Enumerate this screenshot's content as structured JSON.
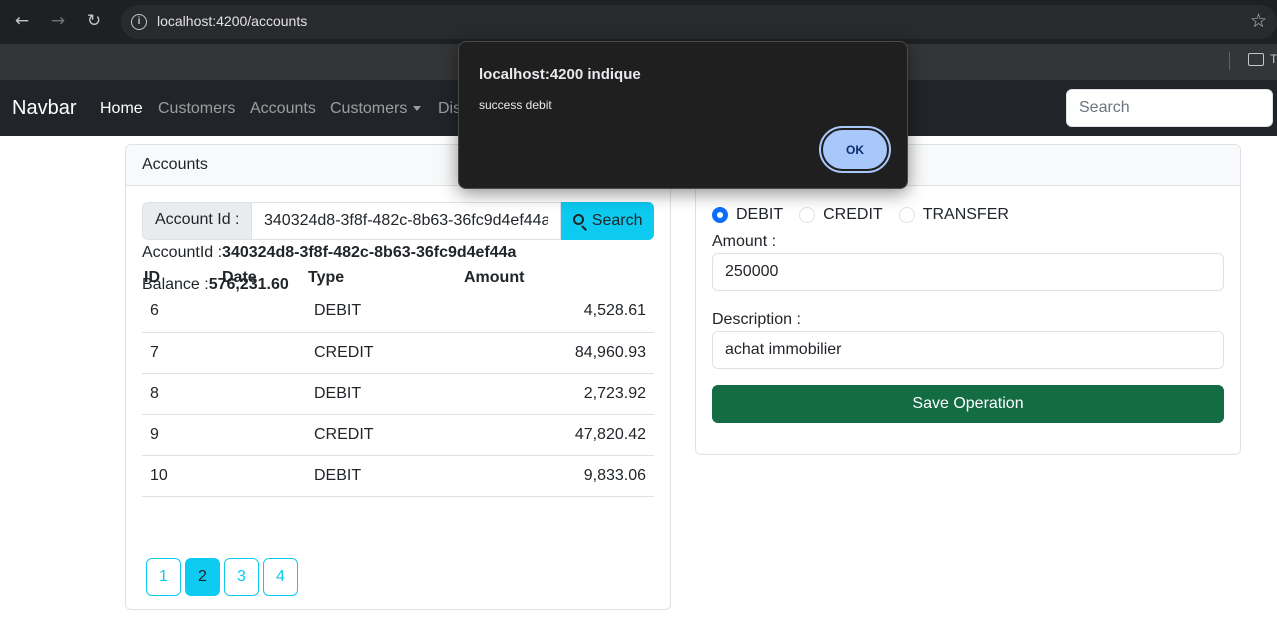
{
  "browser": {
    "url": "localhost:4200/accounts",
    "bookmark_folder_label": "T"
  },
  "navbar": {
    "brand": "Navbar",
    "links": [
      "Home",
      "Customers",
      "Accounts",
      "Customers",
      "Dis"
    ],
    "search_placeholder": "Search"
  },
  "accounts_card": {
    "header": "Accounts",
    "account_id_label": "Account Id :",
    "account_id_value": "340324d8-3f8f-482c-8b63-36fc9d4ef44a",
    "search_button": "Search",
    "account_id_info_label": "AccountId :",
    "account_id_info_value": "340324d8-3f8f-482c-8b63-36fc9d4ef44a",
    "balance_label": "Balance :",
    "balance_value": "576,231.60",
    "table": {
      "headers": [
        "ID",
        "Date",
        "Type",
        "Amount"
      ],
      "rows": [
        {
          "id": "6",
          "date": "",
          "type": "DEBIT",
          "amount": "4,528.61"
        },
        {
          "id": "7",
          "date": "",
          "type": "CREDIT",
          "amount": "84,960.93"
        },
        {
          "id": "8",
          "date": "",
          "type": "DEBIT",
          "amount": "2,723.92"
        },
        {
          "id": "9",
          "date": "",
          "type": "CREDIT",
          "amount": "47,820.42"
        },
        {
          "id": "10",
          "date": "",
          "type": "DEBIT",
          "amount": "9,833.06"
        }
      ]
    },
    "pages": [
      "1",
      "2",
      "3",
      "4"
    ],
    "active_page": "2"
  },
  "operation_card": {
    "radios": [
      "DEBIT",
      "CREDIT",
      "TRANSFER"
    ],
    "selected": "DEBIT",
    "amount_label": "Amount :",
    "amount_value": "250000",
    "description_label": "Description :",
    "description_value": "achat immobilier",
    "save_button": "Save Operation"
  },
  "dialog": {
    "title": "localhost:4200 indique",
    "message": "success debit",
    "ok_button": "OK"
  },
  "colors": {
    "accent_info": "#0dcaf0",
    "primary": "#0d6efd",
    "success": "#146c43",
    "navbar_bg": "#212529",
    "dialog_button": "#a8c7fa"
  }
}
